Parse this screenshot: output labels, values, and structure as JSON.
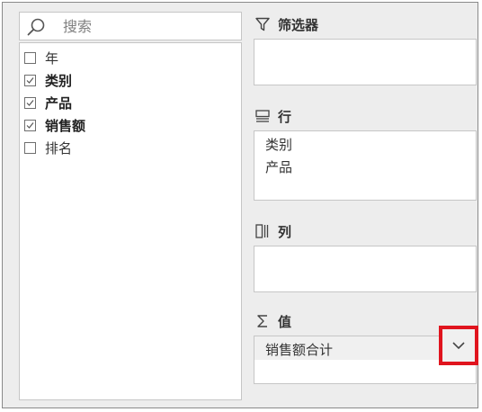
{
  "search": {
    "placeholder": "搜索"
  },
  "fields": [
    {
      "label": "年",
      "checked": false
    },
    {
      "label": "类别",
      "checked": true
    },
    {
      "label": "产品",
      "checked": true
    },
    {
      "label": "销售额",
      "checked": true
    },
    {
      "label": "排名",
      "checked": false
    }
  ],
  "areas": {
    "filters": {
      "title": "筛选器",
      "icon": "filter-icon",
      "items": []
    },
    "rows": {
      "title": "行",
      "icon": "rows-icon",
      "items": [
        "类别",
        "产品"
      ]
    },
    "columns": {
      "title": "列",
      "icon": "columns-icon",
      "items": []
    },
    "values": {
      "title": "值",
      "icon": "sigma-icon",
      "items": [
        "销售额合计"
      ]
    }
  },
  "colors": {
    "highlight": "#e0141e",
    "panel": "#ededed",
    "border": "#c6c6c6"
  }
}
